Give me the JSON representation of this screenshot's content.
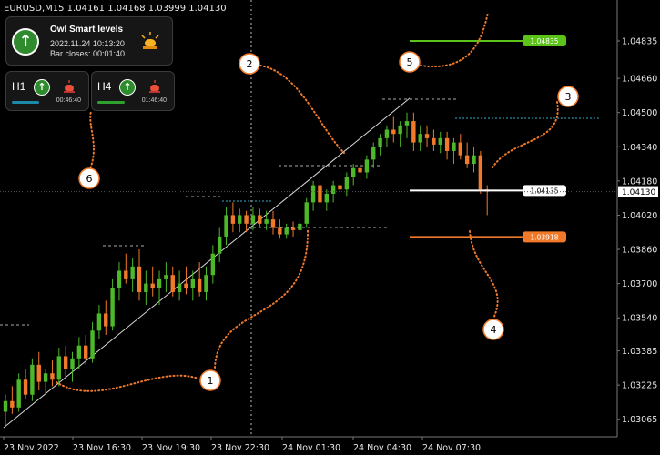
{
  "header": {
    "symbol": "EURUSD,M15",
    "prices": "1.04161 1.04168 1.03999 1.04130"
  },
  "indicator": {
    "title": "Owl Smart levels",
    "datetime": "2022.11.24 10:13:20",
    "bar_closes": "Bar closes: 00:01:40",
    "direction": "up",
    "timeframes": [
      {
        "label": "H1",
        "time": "00:46:40",
        "direction": "up",
        "bar_color": "#1a8aa8"
      },
      {
        "label": "H4",
        "time": "01:46:40",
        "direction": "up",
        "bar_color": "#2ea02e"
      }
    ]
  },
  "colors": {
    "bull": "#4cb82a",
    "bear": "#f07a2a",
    "level_green": "#5cc31a",
    "level_orange": "#f07a2a",
    "level_white": "#ffffff",
    "callout": "#f07a2a"
  },
  "price_axis": [
    "1.04835",
    "1.04660",
    "1.04500",
    "1.04340",
    "1.04180",
    "1.04130",
    "1.04020",
    "1.03860",
    "1.03700",
    "1.03540",
    "1.03385",
    "1.03225",
    "1.03065"
  ],
  "time_axis": [
    "23 Nov 2022",
    "23 Nov 16:30",
    "23 Nov 19:30",
    "23 Nov 22:30",
    "24 Nov 01:30",
    "24 Nov 04:30",
    "24 Nov 07:30"
  ],
  "levels": [
    {
      "name": "target-up",
      "price": "1.04835",
      "color": "#5cc31a"
    },
    {
      "name": "current",
      "price": "1.04135",
      "color": "#ffffff"
    },
    {
      "name": "target-down",
      "price": "1.03918",
      "color": "#f07a2a"
    }
  ],
  "current_price": "1.04130",
  "callouts": [
    "1",
    "2",
    "3",
    "4",
    "5",
    "6"
  ],
  "chart_data": {
    "type": "candlestick",
    "symbol": "EURUSD",
    "timeframe": "M15",
    "ylim": [
      1.03,
      1.0495
    ],
    "candles": [
      [
        1.031,
        1.0318,
        1.0303,
        1.0315
      ],
      [
        1.0315,
        1.0322,
        1.0309,
        1.0312
      ],
      [
        1.0312,
        1.0328,
        1.031,
        1.0325
      ],
      [
        1.0325,
        1.033,
        1.0316,
        1.0318
      ],
      [
        1.0318,
        1.0335,
        1.0315,
        1.0332
      ],
      [
        1.0332,
        1.0338,
        1.032,
        1.0324
      ],
      [
        1.0324,
        1.033,
        1.0318,
        1.0328
      ],
      [
        1.0328,
        1.0334,
        1.0322,
        1.0325
      ],
      [
        1.0325,
        1.034,
        1.0322,
        1.0336
      ],
      [
        1.0336,
        1.0341,
        1.0326,
        1.033
      ],
      [
        1.033,
        1.0338,
        1.0324,
        1.0335
      ],
      [
        1.0335,
        1.0345,
        1.033,
        1.0341
      ],
      [
        1.0341,
        1.0346,
        1.0332,
        1.0335
      ],
      [
        1.0335,
        1.0352,
        1.0333,
        1.0348
      ],
      [
        1.0348,
        1.036,
        1.0344,
        1.0356
      ],
      [
        1.0356,
        1.0362,
        1.0346,
        1.035
      ],
      [
        1.035,
        1.0372,
        1.0348,
        1.0368
      ],
      [
        1.0368,
        1.038,
        1.0362,
        1.0376
      ],
      [
        1.0376,
        1.0384,
        1.037,
        1.0372
      ],
      [
        1.0372,
        1.0382,
        1.0366,
        1.0378
      ],
      [
        1.0378,
        1.0386,
        1.0362,
        1.0366
      ],
      [
        1.0366,
        1.0376,
        1.036,
        1.037
      ],
      [
        1.037,
        1.0378,
        1.0364,
        1.0368
      ],
      [
        1.0368,
        1.0376,
        1.036,
        1.0372
      ],
      [
        1.0372,
        1.038,
        1.0366,
        1.0374
      ],
      [
        1.0374,
        1.0378,
        1.0364,
        1.0366
      ],
      [
        1.0366,
        1.0376,
        1.0362,
        1.037
      ],
      [
        1.037,
        1.0378,
        1.0365,
        1.0368
      ],
      [
        1.0368,
        1.0376,
        1.0362,
        1.0372
      ],
      [
        1.0372,
        1.038,
        1.0364,
        1.0366
      ],
      [
        1.0366,
        1.0378,
        1.0362,
        1.0374
      ],
      [
        1.0374,
        1.0388,
        1.037,
        1.0384
      ],
      [
        1.0384,
        1.0396,
        1.038,
        1.0392
      ],
      [
        1.0392,
        1.0406,
        1.0388,
        1.0402
      ],
      [
        1.0402,
        1.0408,
        1.0394,
        1.0398
      ],
      [
        1.0398,
        1.0405,
        1.0394,
        1.0402
      ],
      [
        1.0402,
        1.0404,
        1.0394,
        1.0398
      ],
      [
        1.0398,
        1.0406,
        1.0395,
        1.0402
      ],
      [
        1.0402,
        1.0405,
        1.0396,
        1.0398
      ],
      [
        1.0398,
        1.0404,
        1.0395,
        1.04
      ],
      [
        1.04,
        1.0404,
        1.0393,
        1.0396
      ],
      [
        1.0396,
        1.04,
        1.0391,
        1.0393
      ],
      [
        1.0393,
        1.0398,
        1.0391,
        1.0396
      ],
      [
        1.0396,
        1.0399,
        1.0392,
        1.0395
      ],
      [
        1.0395,
        1.04,
        1.0393,
        1.0398
      ],
      [
        1.0398,
        1.041,
        1.0396,
        1.0408
      ],
      [
        1.0408,
        1.0418,
        1.0404,
        1.0416
      ],
      [
        1.0416,
        1.0419,
        1.0404,
        1.0408
      ],
      [
        1.0408,
        1.0414,
        1.0404,
        1.0412
      ],
      [
        1.0412,
        1.0418,
        1.0408,
        1.0416
      ],
      [
        1.0416,
        1.042,
        1.041,
        1.0414
      ],
      [
        1.0414,
        1.0422,
        1.0411,
        1.042
      ],
      [
        1.042,
        1.0426,
        1.0416,
        1.0424
      ],
      [
        1.0424,
        1.0428,
        1.0418,
        1.0422
      ],
      [
        1.0422,
        1.043,
        1.0419,
        1.0428
      ],
      [
        1.0428,
        1.0436,
        1.0424,
        1.0434
      ],
      [
        1.0434,
        1.044,
        1.043,
        1.0438
      ],
      [
        1.0438,
        1.0444,
        1.0434,
        1.0442
      ],
      [
        1.0442,
        1.0448,
        1.0436,
        1.044
      ],
      [
        1.044,
        1.0446,
        1.0434,
        1.0444
      ],
      [
        1.0444,
        1.045,
        1.0438,
        1.0446
      ],
      [
        1.0446,
        1.045,
        1.0432,
        1.0436
      ],
      [
        1.0436,
        1.0444,
        1.0432,
        1.044
      ],
      [
        1.044,
        1.0444,
        1.0434,
        1.0438
      ],
      [
        1.0438,
        1.0442,
        1.0432,
        1.0435
      ],
      [
        1.0435,
        1.0441,
        1.0431,
        1.0438
      ],
      [
        1.0438,
        1.0441,
        1.0428,
        1.0432
      ],
      [
        1.0432,
        1.0438,
        1.0426,
        1.0436
      ],
      [
        1.0436,
        1.044,
        1.0428,
        1.043
      ],
      [
        1.043,
        1.0436,
        1.0424,
        1.0426
      ],
      [
        1.0426,
        1.0434,
        1.0422,
        1.043
      ],
      [
        1.043,
        1.0432,
        1.0412,
        1.0414
      ],
      [
        1.0414,
        1.0416,
        1.0402,
        1.0413
      ]
    ]
  }
}
